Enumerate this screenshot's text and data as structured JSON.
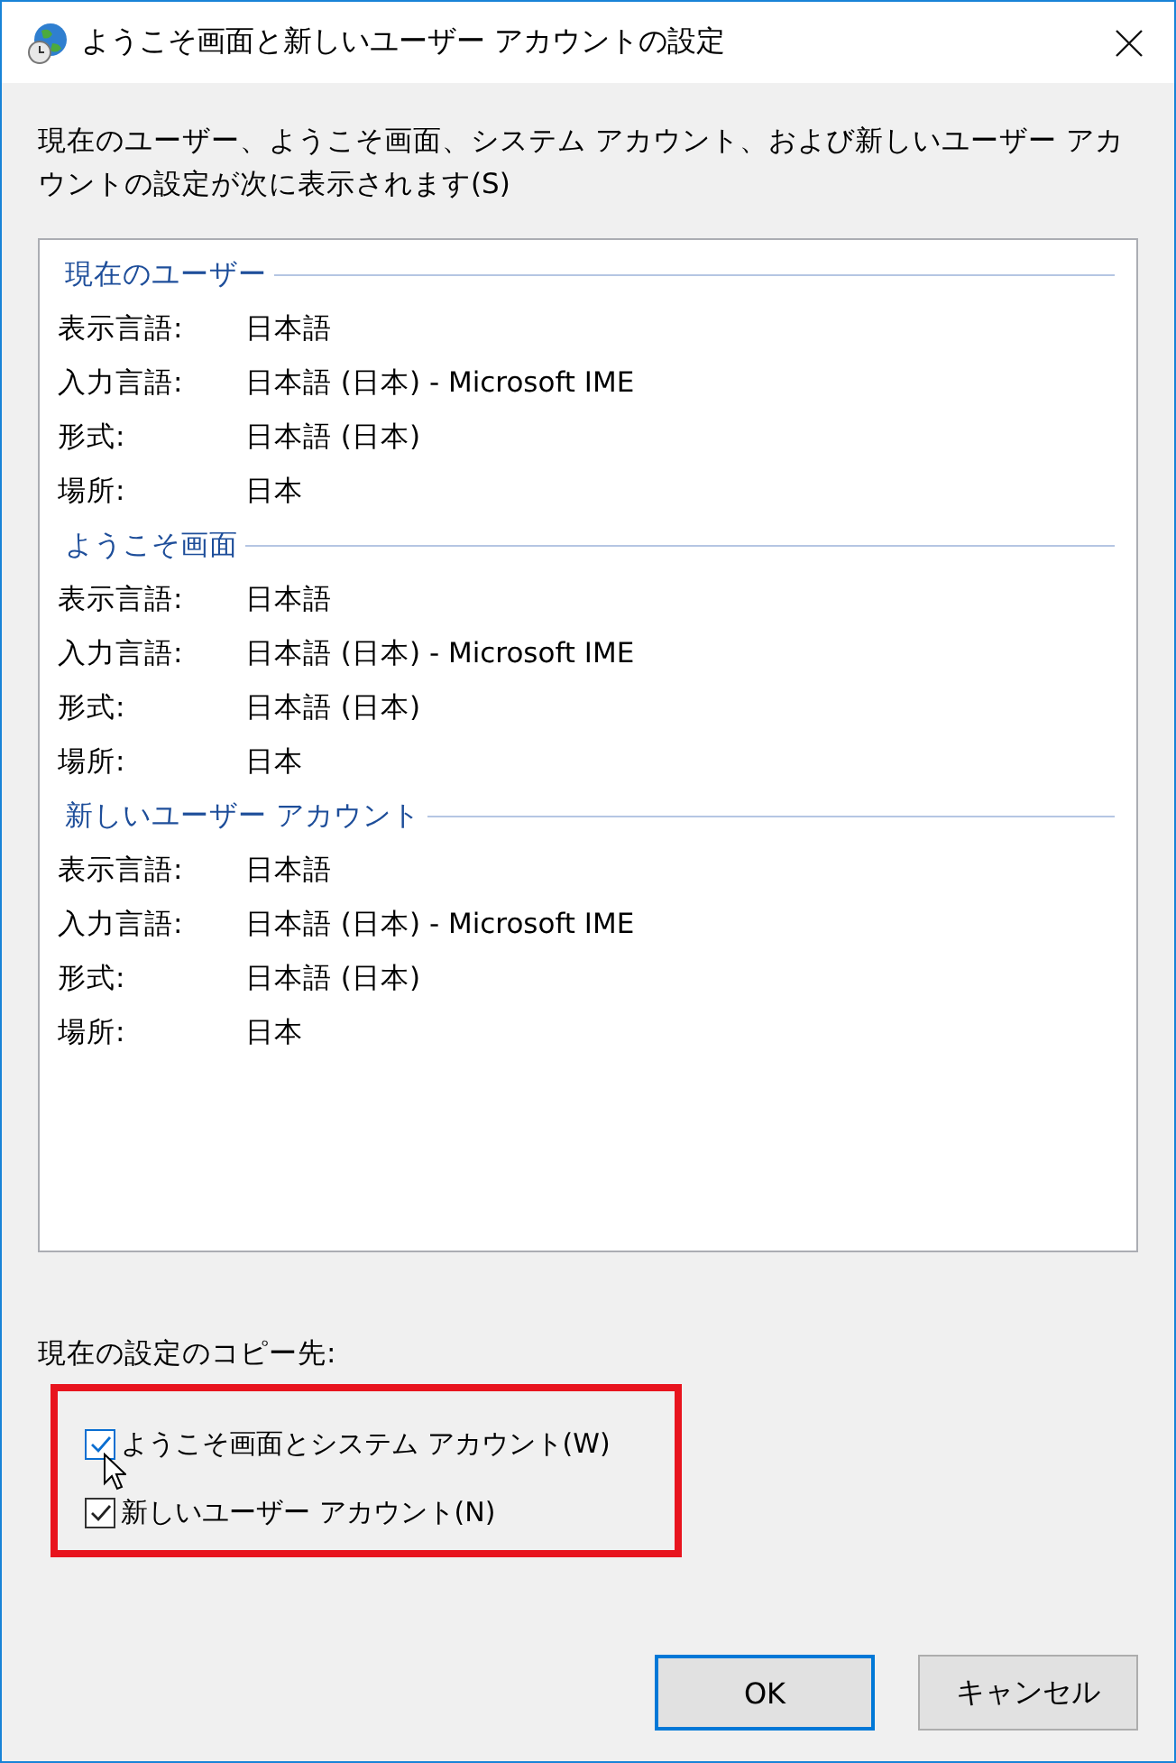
{
  "window": {
    "title": "ようこそ画面と新しいユーザー アカウントの設定"
  },
  "description": "現在のユーザー、ようこそ画面、システム アカウント、および新しいユーザー アカウントの設定が次に表示されます(S)",
  "groups": [
    {
      "title": "現在のユーザー",
      "rows": [
        {
          "label": "表示言語:",
          "value": "日本語"
        },
        {
          "label": "入力言語:",
          "value": "日本語 (日本) - Microsoft IME"
        },
        {
          "label": "形式:",
          "value": "日本語 (日本)"
        },
        {
          "label": "場所:",
          "value": "日本"
        }
      ]
    },
    {
      "title": "ようこそ画面",
      "rows": [
        {
          "label": "表示言語:",
          "value": "日本語"
        },
        {
          "label": "入力言語:",
          "value": "日本語 (日本) - Microsoft IME"
        },
        {
          "label": "形式:",
          "value": "日本語 (日本)"
        },
        {
          "label": "場所:",
          "value": "日本"
        }
      ]
    },
    {
      "title": "新しいユーザー アカウント",
      "rows": [
        {
          "label": "表示言語:",
          "value": "日本語"
        },
        {
          "label": "入力言語:",
          "value": "日本語 (日本) - Microsoft IME"
        },
        {
          "label": "形式:",
          "value": "日本語 (日本)"
        },
        {
          "label": "場所:",
          "value": "日本"
        }
      ]
    }
  ],
  "copy_to": {
    "label": "現在の設定のコピー先:",
    "options": [
      {
        "label": "ようこそ画面とシステム アカウント(W)",
        "checked": true,
        "hovered": true
      },
      {
        "label": "新しいユーザー アカウント(N)",
        "checked": true,
        "hovered": false
      }
    ]
  },
  "buttons": [
    {
      "label": "OK",
      "default": true
    },
    {
      "label": "キャンセル",
      "default": false
    }
  ]
}
